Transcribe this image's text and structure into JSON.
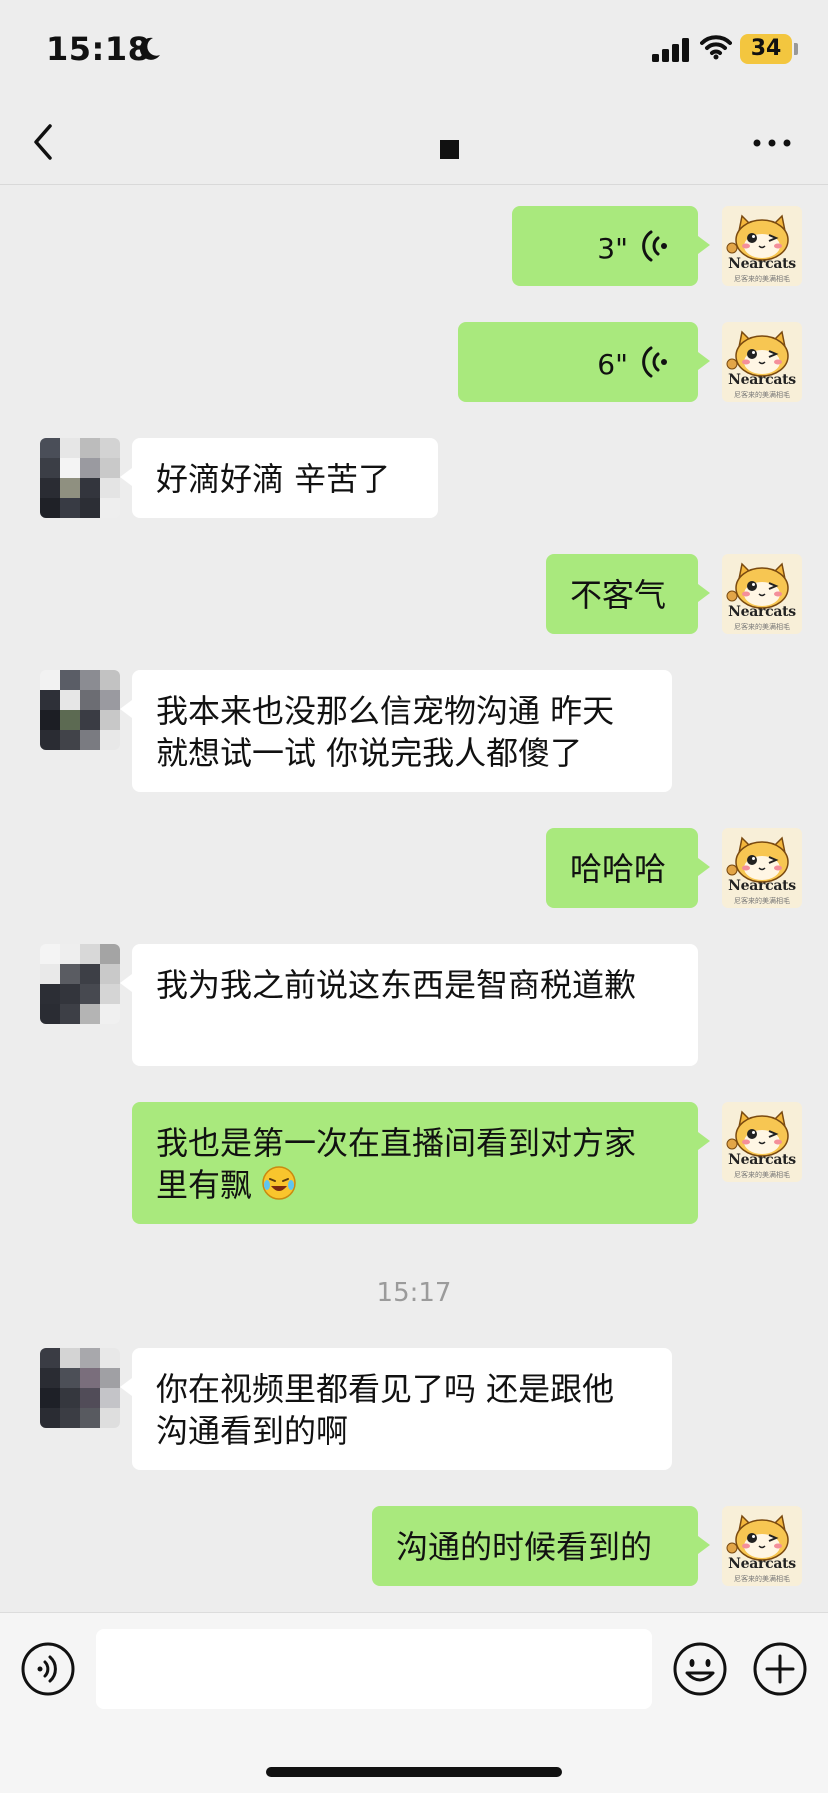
{
  "status_bar": {
    "time": "15:18",
    "battery": "34"
  },
  "nav": {
    "back_icon": "chevron-left-icon",
    "more_icon": "more-dots-icon"
  },
  "messages": [
    {
      "side": "out",
      "type": "voice",
      "duration": "3\""
    },
    {
      "side": "out",
      "type": "voice",
      "duration": "6\""
    },
    {
      "side": "in",
      "type": "text",
      "text": "好滴好滴 辛苦了"
    },
    {
      "side": "out",
      "type": "text",
      "text": "不客气"
    },
    {
      "side": "in",
      "type": "text",
      "text": "我本来也没那么信宠物沟通 昨天\n就想试一试 你说完我人都傻了"
    },
    {
      "side": "out",
      "type": "text",
      "text": "哈哈哈"
    },
    {
      "side": "in",
      "type": "text",
      "text": "我为我之前说这东西是智商税道歉"
    },
    {
      "side": "out",
      "type": "text",
      "text": "我也是第一次在直播间看到对方家\n里有飘"
    },
    {
      "side": "in",
      "type": "text",
      "text": "你在视频里都看见了吗 还是跟他\n沟通看到的啊"
    },
    {
      "side": "out",
      "type": "text",
      "text": "沟通的时候看到的"
    }
  ],
  "timestamp": "15:17",
  "avatar": {
    "label": "Nearcats",
    "sub": "尼客来的美满相毛"
  },
  "colors": {
    "out_bubble": "#a9e97d",
    "in_bubble": "#ffffff",
    "background": "#ededed"
  },
  "input_bar": {
    "placeholder": "",
    "icons": [
      "voice-icon",
      "emoji-icon",
      "plus-icon"
    ]
  }
}
